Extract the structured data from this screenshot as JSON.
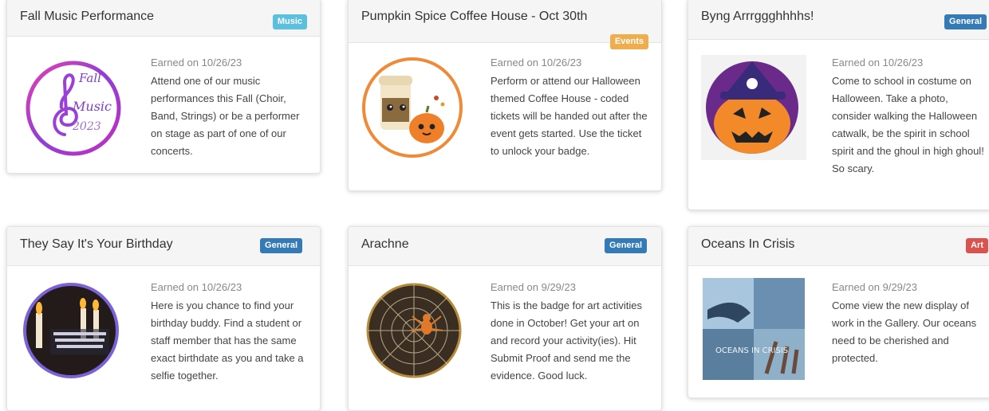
{
  "cards": [
    {
      "title": "Fall Music Performance",
      "category": "Music",
      "earned": "Earned on 10/26/23",
      "description": "Attend one of our music performances this Fall (Choir, Band, Strings) or be a performer on stage as part of one of our concerts.",
      "image_text": [
        "Fall",
        "Music",
        "2023"
      ]
    },
    {
      "title": "Pumpkin Spice Coffee House - Oct 30th",
      "category": "Events",
      "earned": "Earned on 10/26/23",
      "description": "Perform or attend our Halloween themed Coffee House - coded tickets will be handed out after the event gets started. Use the ticket to unlock your badge."
    },
    {
      "title": "Byng Arrrggghhhhs!",
      "category": "General",
      "earned": "Earned on 10/26/23",
      "description": "Come to school in costume on Halloween. Take a photo, consider walking the Halloween catwalk, be the spirit in school spirit and the ghoul in high ghoul! So scary."
    },
    {
      "title": "They Say It's Your Birthday",
      "category": "General",
      "earned": "Earned on 10/26/23",
      "description": "Here is you chance to find your birthday buddy. Find a student or staff member that has the same exact birthdate as you and take a selfie together."
    },
    {
      "title": "Arachne",
      "category": "General",
      "earned": "Earned on 9/29/23",
      "description": "This is the badge for art activities done in October! Get your art on and record your activity(ies). Hit Submit Proof and send me the evidence. Good luck."
    },
    {
      "title": "Oceans In Crisis",
      "category": "Art",
      "earned": "Earned on 9/29/23",
      "description": "Come view the new display of work in the Gallery. Our oceans need to be cherished and protected.",
      "image_text": "OCEANS IN CRISIS"
    }
  ]
}
